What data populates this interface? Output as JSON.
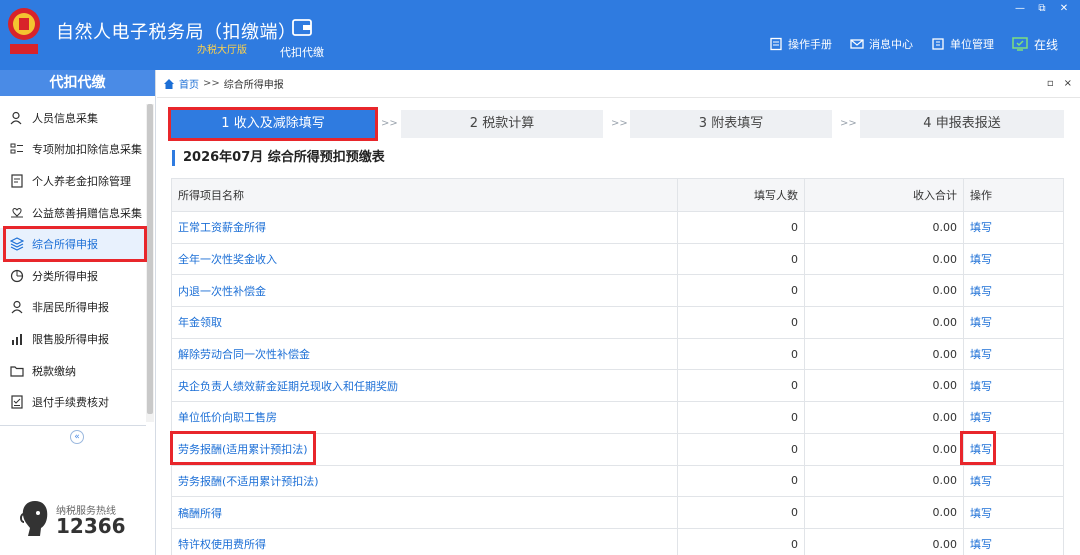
{
  "window": {
    "minimize": "—",
    "maximize": "⧉",
    "close": "✕"
  },
  "header": {
    "title": "自然人电子税务局（扣缴端）",
    "subtitle": "办税大厅版",
    "module": "代扣代缴",
    "links": [
      "操作手册",
      "消息中心",
      "单位管理"
    ],
    "status": "在线",
    "bg_color": "#2f7be0"
  },
  "sidebar": {
    "title": "代扣代缴",
    "items": [
      {
        "label": "人员信息采集",
        "icon": "person-icon"
      },
      {
        "label": "专项附加扣除信息采集",
        "icon": "list-icon"
      },
      {
        "label": "个人养老金扣除管理",
        "icon": "document-icon"
      },
      {
        "label": "公益慈善捐赠信息采集",
        "icon": "donation-icon"
      },
      {
        "label": "综合所得申报",
        "icon": "layers-icon",
        "active": true
      },
      {
        "label": "分类所得申报",
        "icon": "pie-icon"
      },
      {
        "label": "非居民所得申报",
        "icon": "person-outline-icon"
      },
      {
        "label": "限售股所得申报",
        "icon": "bar-chart-icon"
      },
      {
        "label": "税款缴纳",
        "icon": "folder-icon"
      },
      {
        "label": "退付手续费核对",
        "icon": "checklist-icon"
      }
    ],
    "collapse": "«",
    "hotline_label": "纳税服务热线",
    "hotline_number": "12366"
  },
  "breadcrumb": {
    "home": "首页",
    "sep": ">>",
    "current": "综合所得申报",
    "ctrl_min": "▫",
    "ctrl_close": "×"
  },
  "steps": [
    {
      "label": "1 收入及减除填写",
      "active": true
    },
    {
      "label": "2 税款计算"
    },
    {
      "label": "3 附表填写"
    },
    {
      "label": "4 申报表报送"
    }
  ],
  "step_arrow": ">>",
  "section_title": "2026年07月  综合所得预扣预缴表",
  "table": {
    "headers": [
      "所得项目名称",
      "填写人数",
      "收入合计",
      "操作"
    ],
    "rows": [
      {
        "name": "正常工资薪金所得",
        "count": "0",
        "income": "0.00",
        "op": "填写"
      },
      {
        "name": "全年一次性奖金收入",
        "count": "0",
        "income": "0.00",
        "op": "填写"
      },
      {
        "name": "内退一次性补偿金",
        "count": "0",
        "income": "0.00",
        "op": "填写"
      },
      {
        "name": "年金领取",
        "count": "0",
        "income": "0.00",
        "op": "填写"
      },
      {
        "name": "解除劳动合同一次性补偿金",
        "count": "0",
        "income": "0.00",
        "op": "填写"
      },
      {
        "name": "央企负责人绩效薪金延期兑现收入和任期奖励",
        "count": "0",
        "income": "0.00",
        "op": "填写"
      },
      {
        "name": "单位低价向职工售房",
        "count": "0",
        "income": "0.00",
        "op": "填写"
      },
      {
        "name": "劳务报酬(适用累计预扣法)",
        "count": "0",
        "income": "0.00",
        "op": "填写"
      },
      {
        "name": "劳务报酬(不适用累计预扣法)",
        "count": "0",
        "income": "0.00",
        "op": "填写"
      },
      {
        "name": "稿酬所得",
        "count": "0",
        "income": "0.00",
        "op": "填写"
      },
      {
        "name": "特许权使用费所得",
        "count": "0",
        "income": "0.00",
        "op": "填写"
      }
    ]
  },
  "colors": {
    "accent": "#2f7be0",
    "link": "#1c6fd6",
    "highlight": "#e8262b"
  }
}
